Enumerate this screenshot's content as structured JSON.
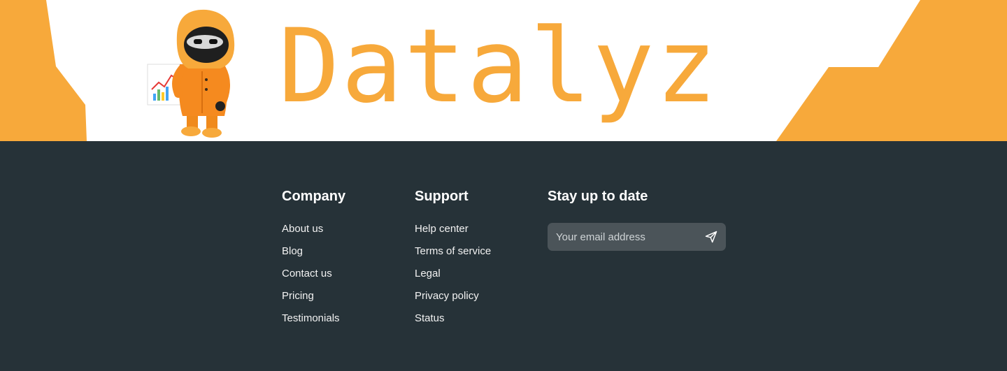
{
  "brand": {
    "name": "Datalyz",
    "accent_color": "#F7A93B",
    "mascot_icon": "hooded-mascot-with-chart-icon"
  },
  "footer": {
    "background_color": "#263238",
    "company": {
      "heading": "Company",
      "links": [
        "About us",
        "Blog",
        "Contact us",
        "Pricing",
        "Testimonials"
      ]
    },
    "support": {
      "heading": "Support",
      "links": [
        "Help center",
        "Terms of service",
        "Legal",
        "Privacy policy",
        "Status"
      ]
    },
    "newsletter": {
      "heading": "Stay up to date",
      "email_placeholder": "Your email address",
      "email_value": "",
      "send_icon": "send-icon"
    }
  }
}
